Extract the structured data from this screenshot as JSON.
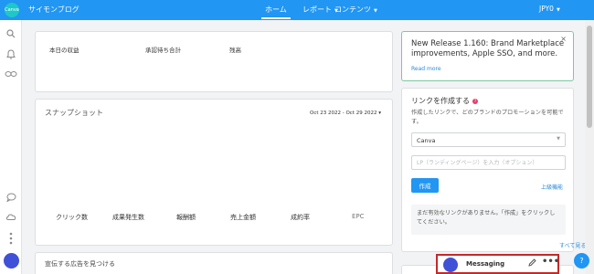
{
  "header": {
    "logo_text": "Canva",
    "site_name": "サイモンブログ",
    "nav": [
      {
        "label": "ホーム"
      },
      {
        "label": "レポート"
      },
      {
        "label": "コンテンツ"
      }
    ],
    "currency": "JPY0",
    "accent_color": "#2196f3"
  },
  "sidebar": {
    "icons": [
      "search-icon",
      "bell-icon",
      "infinity-icon",
      "chat-bubble-icon",
      "cloud-icon",
      "vertical-dots-icon",
      "avatar"
    ]
  },
  "stats": {
    "labels": [
      "本日の収益",
      "承認待ち合計",
      "残高"
    ]
  },
  "snapshot": {
    "title": "スナップショット",
    "date_range": "Oct 23 2022 - Oct 29 2022",
    "metrics": [
      "クリック数",
      "成果発生数",
      "報酬額",
      "売上金額",
      "成約率",
      "EPC"
    ]
  },
  "find_ads": {
    "title": "宣伝する広告を見つける"
  },
  "release": {
    "text": "New Release 1.160: Brand Marketplace improvements, Apple SSO, and more.",
    "link": "Read more",
    "close": "×"
  },
  "create_link": {
    "title": "リンクを作成する",
    "help": "?",
    "description": "作成したリンクで、どのブランドのプロモーションを可能です。",
    "brand_select": "Canva",
    "lp_placeholder": "LP（ランディングページ）を入力（オプション）",
    "create_button": "作成",
    "advanced_link": "上級機能",
    "empty_message": "まだ有効なリンクがありません。「作成」をクリックしてください。",
    "see_all": "すべて見る"
  },
  "messaging": {
    "label": "Messaging",
    "more": "•••"
  },
  "help_fab": "?"
}
